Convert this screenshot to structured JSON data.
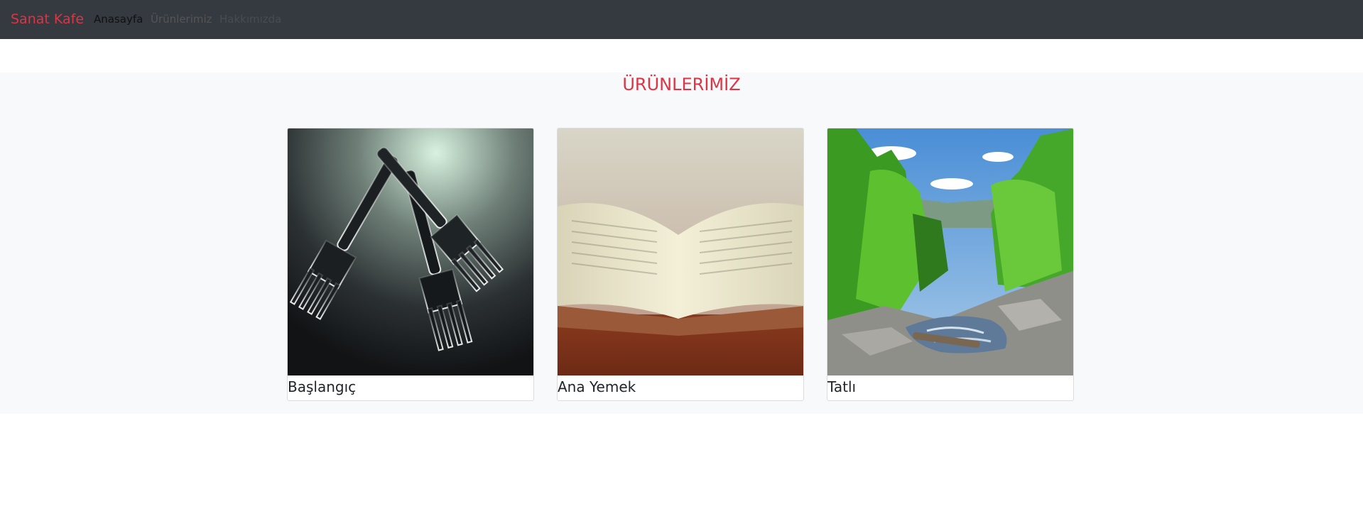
{
  "navbar": {
    "brand": "Sanat Kafe",
    "links": [
      {
        "label": "Anasayfa"
      },
      {
        "label": "Ürünlerimiz"
      },
      {
        "label": "Hakkımızda"
      }
    ]
  },
  "products": {
    "title": "ÜRÜNLERİMİZ",
    "cards": [
      {
        "title": "Başlangıç",
        "image": "forks-photo"
      },
      {
        "title": "Ana Yemek",
        "image": "open-book-photo"
      },
      {
        "title": "Tatlı",
        "image": "forest-waterfall-photo"
      }
    ]
  },
  "colors": {
    "navbar_bg": "#343a40",
    "brand": "#dc3545",
    "section_bg": "#f8f9fa"
  }
}
